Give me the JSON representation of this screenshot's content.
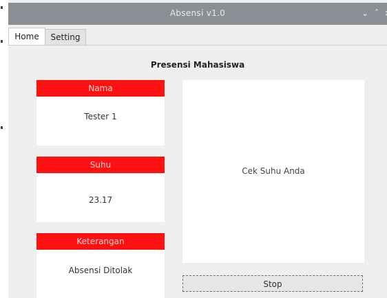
{
  "window": {
    "title": "Absensi v1.0",
    "controls": [
      "minimize-icon",
      "maximize-icon",
      "close-icon"
    ]
  },
  "tabs": [
    {
      "label": "Home",
      "active": true
    },
    {
      "label": "Setting",
      "active": false
    }
  ],
  "main": {
    "heading": "Presensi Mahasiswa",
    "boxes": [
      {
        "label": "Nama",
        "value": "Tester 1"
      },
      {
        "label": "Suhu",
        "value": "23.17"
      },
      {
        "label": "Keterangan",
        "value": "Absensi Ditolak"
      }
    ],
    "panel_message": "Cek Suhu Anda",
    "stop_label": "Stop"
  },
  "colors": {
    "label_bg": "#ff1111",
    "titlebar_bg": "#8a8f96"
  }
}
